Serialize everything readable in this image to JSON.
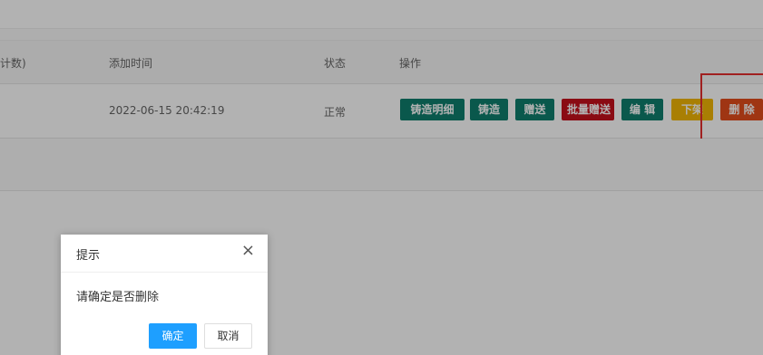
{
  "table": {
    "headers": [
      "计数)",
      "添加时间",
      "状态",
      "操作"
    ],
    "row": {
      "added_time": "2022-06-15 20:42:19",
      "status": "正常"
    },
    "actions": [
      "铸造明细",
      "铸造",
      "赠送",
      "批量赠送",
      "编 辑",
      "下架",
      "删 除"
    ]
  },
  "dialog": {
    "title": "提示",
    "close": "×",
    "message": "请确定是否删除",
    "ok": "确定",
    "cancel": "取消"
  },
  "colors": {
    "teal": "#0f7f6e",
    "red": "#c6101c",
    "yellow": "#f2b705",
    "orange": "#e44c1c",
    "primary": "#1e9fff",
    "highlight": "#e62e2e"
  }
}
